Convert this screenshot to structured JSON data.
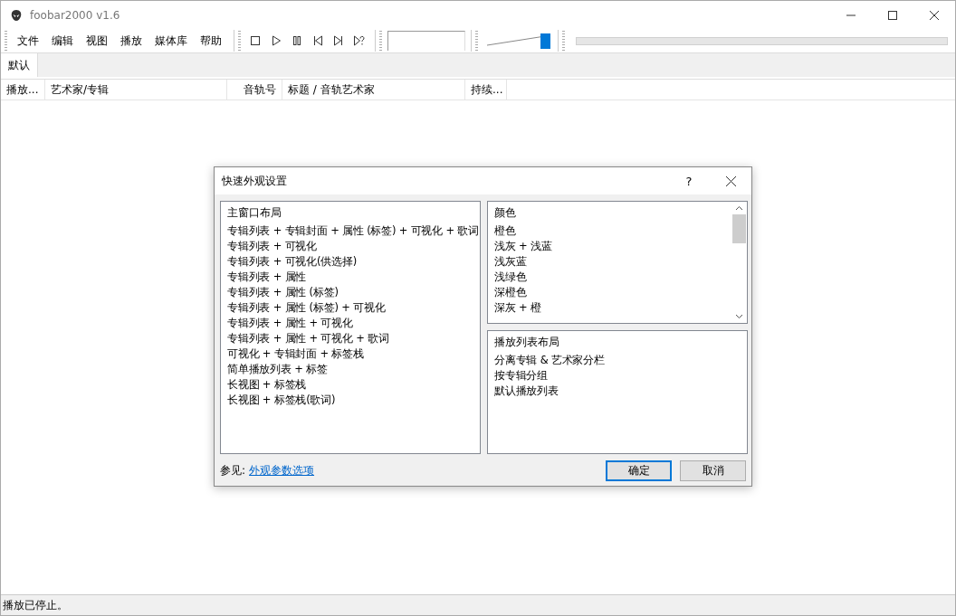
{
  "window": {
    "title": "foobar2000 v1.6"
  },
  "menu": [
    "文件",
    "编辑",
    "视图",
    "播放",
    "媒体库",
    "帮助"
  ],
  "volume": {
    "level": 0.95
  },
  "playlist_tabs": [
    {
      "label": "默认",
      "selected": true
    }
  ],
  "columns": [
    "播放...",
    "艺术家/专辑",
    "音轨号",
    "标题 / 音轨艺术家",
    "持续..."
  ],
  "dialog": {
    "title": "快速外观设置",
    "help": "?",
    "layouts": {
      "heading": "主窗口布局",
      "items": [
        "专辑列表 + 专辑封面 + 属性 (标签) + 可视化 + 歌词",
        "专辑列表 + 可视化",
        "专辑列表 + 可视化(供选择)",
        "专辑列表 + 属性",
        "专辑列表 + 属性 (标签)",
        "专辑列表 + 属性 (标签) + 可视化",
        "专辑列表 + 属性 + 可视化",
        "专辑列表 + 属性 + 可视化 + 歌词",
        "可视化 + 专辑封面 + 标签栈",
        "简单播放列表 + 标签",
        "长视图 + 标签栈",
        "长视图 + 标签栈(歌词)"
      ]
    },
    "colors": {
      "heading": "颜色",
      "items": [
        "橙色",
        "浅灰 + 浅蓝",
        "浅灰蓝",
        "浅绿色",
        "深橙色",
        "深灰 + 橙"
      ]
    },
    "playlist_layouts": {
      "heading": "播放列表布局",
      "items": [
        "分离专辑 & 艺术家分栏",
        "按专辑分组",
        "默认播放列表"
      ]
    },
    "see_also": "参见:",
    "link": "外观参数选项",
    "buttons": [
      {
        "label": "确定",
        "default": true
      },
      {
        "label": "取消",
        "default": false
      }
    ]
  },
  "status_bar": "播放已停止。"
}
